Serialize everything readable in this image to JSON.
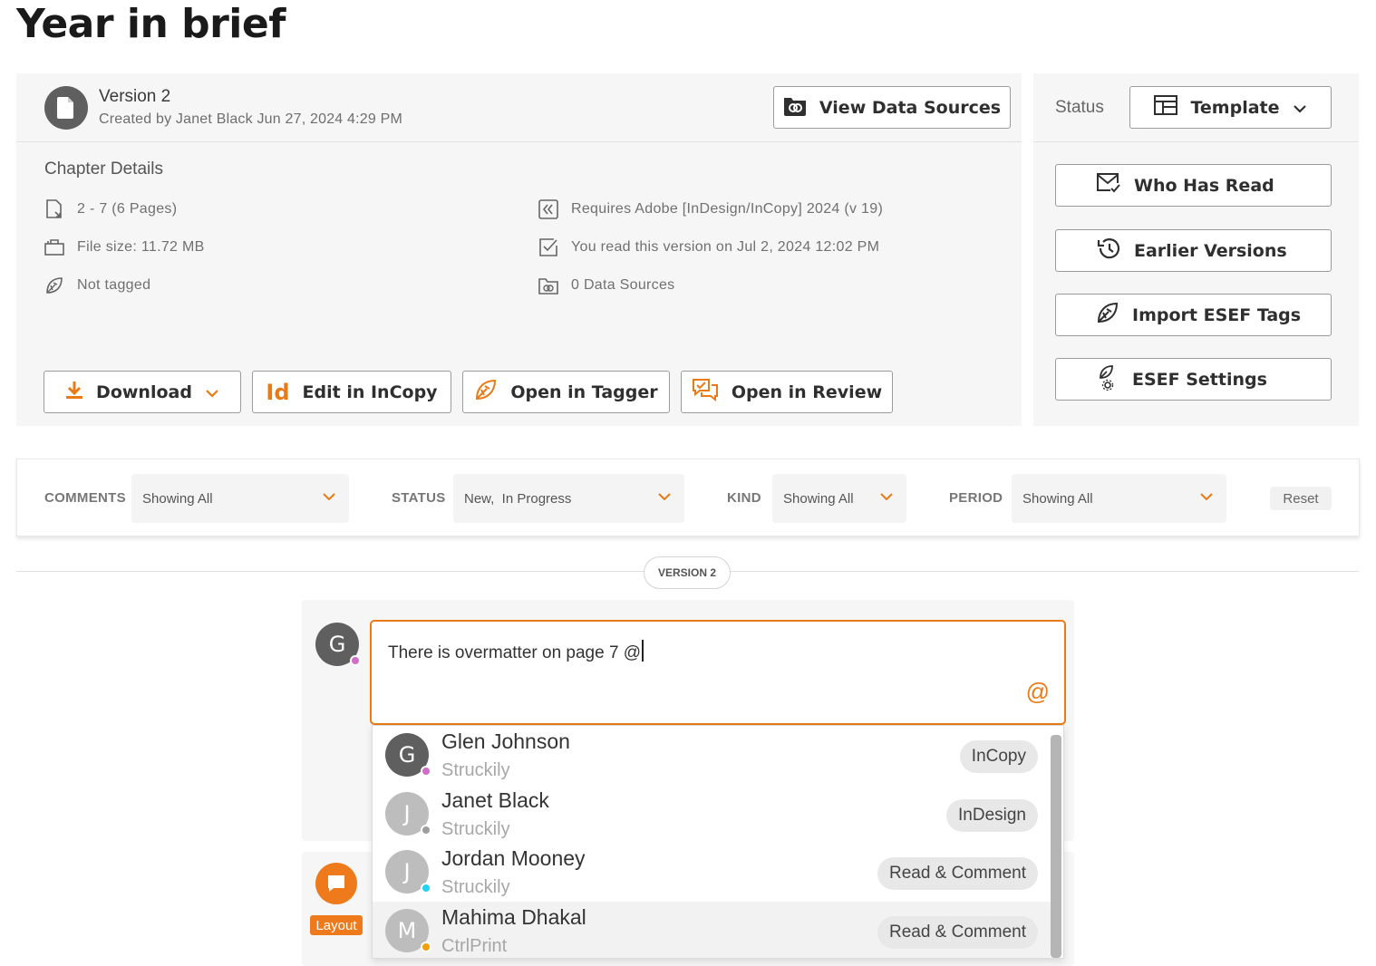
{
  "page": {
    "title": "Year in brief"
  },
  "version": {
    "title": "Version 2",
    "created": "Created by Janet Black Jun 27, 2024 4:29 PM",
    "view_sources_label": "View Data Sources"
  },
  "details": {
    "heading": "Chapter Details",
    "pages": "2 - 7 (6 Pages)",
    "file_size": "File size: 11.72 MB",
    "tagged": "Not tagged",
    "requires": "Requires Adobe [InDesign/InCopy] 2024 (v 19)",
    "read": "You read this version on Jul 2, 2024 12:02 PM",
    "sources": "0 Data Sources"
  },
  "actions": {
    "download": "Download",
    "edit": "Edit in InCopy",
    "tagger": "Open in Tagger",
    "review": "Open in Review"
  },
  "status": {
    "label": "Status",
    "value": "Template",
    "who_has_read": "Who Has Read",
    "earlier_versions": "Earlier Versions",
    "import_esef": "Import ESEF Tags",
    "esef_settings": "ESEF Settings"
  },
  "filters": {
    "comments_label": "COMMENTS",
    "comments_value": "Showing All",
    "status_label": "STATUS",
    "status_value": "New,  In Progress",
    "kind_label": "KIND",
    "kind_value": "Showing All",
    "period_label": "PERIOD",
    "period_value": "Showing All",
    "reset": "Reset"
  },
  "version_divider": "VERSION 2",
  "composer": {
    "avatar_letter": "G",
    "text": "There is overmatter on page 7 @",
    "mention_icon": "at-icon"
  },
  "layout_tag": "Layout",
  "mentions": [
    {
      "initial": "G",
      "name": "Glen Johnson",
      "org": "Struckily",
      "role": "InCopy",
      "avatar_color": "#5f5f5f",
      "status_color": "#d36bc8"
    },
    {
      "initial": "J",
      "name": "Janet Black",
      "org": "Struckily",
      "role": "InDesign",
      "avatar_color": "#bdbdbd",
      "status_color": "#9e9e9e"
    },
    {
      "initial": "J",
      "name": "Jordan Mooney",
      "org": "Struckily",
      "role": "Read & Comment",
      "avatar_color": "#bdbdbd",
      "status_color": "#22d3ee"
    },
    {
      "initial": "M",
      "name": "Mahima Dhakal",
      "org": "CtrlPrint",
      "role": "Read & Comment",
      "avatar_color": "#bdbdbd",
      "status_color": "#f59e0b"
    }
  ],
  "colors": {
    "accent": "#e97a15",
    "panel": "#f6f6f6"
  }
}
